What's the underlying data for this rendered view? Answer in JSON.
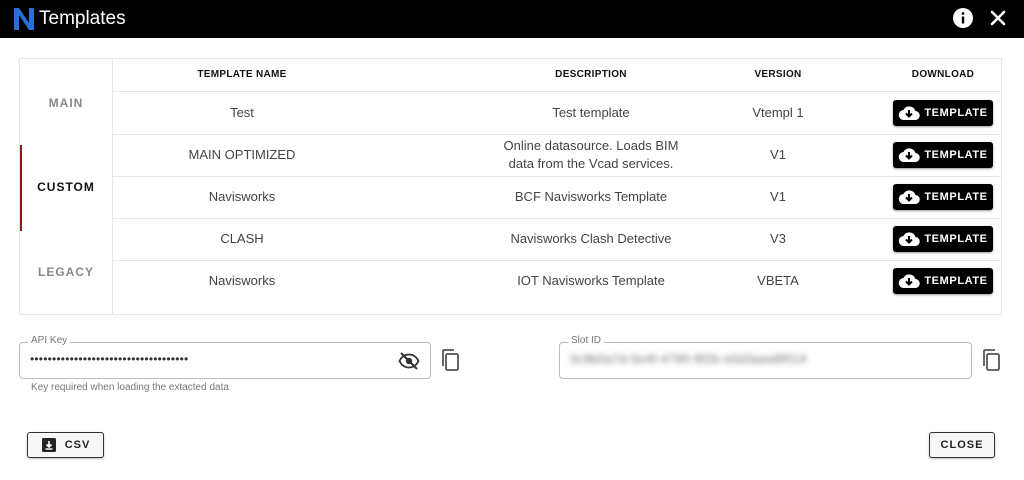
{
  "window": {
    "title": "Templates",
    "logo_letter": "N",
    "colors": {
      "titlebar": "#000000",
      "accent": "#2a6fdb",
      "nav_indicator": "#8b1a1a"
    }
  },
  "sidenav": {
    "items": [
      {
        "label": "MAIN",
        "active": false
      },
      {
        "label": "CUSTOM",
        "active": true
      },
      {
        "label": "LEGACY",
        "active": false
      }
    ]
  },
  "table": {
    "headers": {
      "name": "TEMPLATE NAME",
      "description": "DESCRIPTION",
      "version": "VERSION",
      "download": "DOWNLOAD"
    },
    "rows": [
      {
        "name": "Test",
        "description": "Test template",
        "version": "Vtempl 1",
        "download": "TEMPLATE"
      },
      {
        "name": "MAIN OPTIMIZED",
        "description": "Online datasource. Loads BIM data from the Vcad services.",
        "version": "V1",
        "download": "TEMPLATE"
      },
      {
        "name": "Navisworks",
        "description": "BCF Navisworks Template",
        "version": "V1",
        "download": "TEMPLATE"
      },
      {
        "name": "CLASH",
        "description": "Navisworks Clash Detective",
        "version": "V3",
        "download": "TEMPLATE"
      },
      {
        "name": "Navisworks",
        "description": "IOT Navisworks Template",
        "version": "VBETA",
        "download": "TEMPLATE"
      }
    ]
  },
  "api_key": {
    "label": "API Key",
    "value": "••••••••••••••••••••••••••••••••••••",
    "hint": "Key required when loading the extacted data"
  },
  "slot_id": {
    "label": "Slot ID",
    "value": "3c9b0a7d-5e4f-4790-9f2b-e0d3aea8f014"
  },
  "footer": {
    "csv_label": "CSV",
    "close_label": "CLOSE"
  },
  "icons": [
    "info-icon",
    "close-icon",
    "cloud-download-icon",
    "eye-off-icon",
    "copy-icon",
    "download-box-icon"
  ]
}
